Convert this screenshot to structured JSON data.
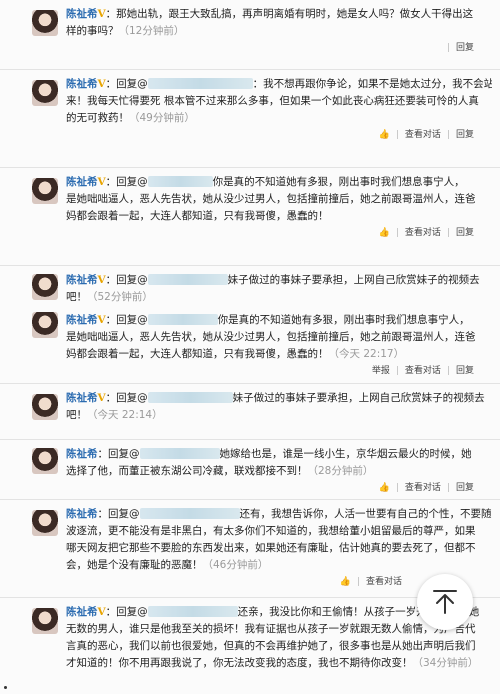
{
  "posts": [
    {
      "name": "陈祉希",
      "v": "V",
      "lines": [
        "：那她出轨，跟王大致乱搞，再声明离婚有明时，她是女人吗？做女人干得出这",
        "样的事吗？"
      ],
      "time": "（12分钟前）",
      "actions": {
        "like": "",
        "forward": "",
        "reply": "回复"
      }
    },
    {
      "name": "陈祉希",
      "v": "V",
      "prefix": "：回复@",
      "lines": [
        "：我不想再跟你争论，如果不是她太过分，我不会站出",
        "来！我每天忙得要死 根本管不过来那么多事，但如果一个如此丧心病狂还要装可怜的人真",
        "的无可救药！"
      ],
      "time": "（49分钟前）",
      "actions": {
        "like": "",
        "forward": "查看对话",
        "reply": "回复"
      }
    },
    {
      "name": "陈祉希",
      "v": "V",
      "prefix": "：回复@",
      "lines": [
        "你是真的不知道她有多狠，刚出事时我们想息事宁人，",
        "是她咄咄逼人，恶人先告状，她从没少过男人，包括撞前撞后，她之前跟哥温州人，连爸",
        "妈都会跟着一起，大连人都知道，只有我哥傻，愚蠢的！"
      ],
      "time": "",
      "actions": {
        "like": "",
        "forward": "查看对话",
        "reply": "回复"
      }
    },
    {
      "name": "陈祉希",
      "v": "V",
      "prefix": "：回复@",
      "lines": [
        "妹子做过的事妹子要承担，上网自己欣赏妹子的视频去",
        "吧！"
      ],
      "time": "（52分钟前）",
      "actions": {
        "like": "",
        "forward": "",
        "reply": ""
      }
    },
    {
      "name": "陈祉希",
      "v": "V",
      "prefix": "：回复@",
      "lines": [
        "你是真的不知道她有多狠，刚出事时我们想息事宁人，",
        "是她咄咄逼人，恶人先告状，她从没少过男人，包括撞前撞后，她之前跟哥温州人，连爸",
        "妈都会跟着一起，大连人都知道，只有我哥傻，愚蠢的！"
      ],
      "time": "（今天 22:17）",
      "actions": {
        "like": "举报",
        "forward": "查看对话",
        "reply": "回复"
      }
    },
    {
      "name": "陈祉希",
      "v": "V",
      "prefix": "：回复@",
      "lines": [
        "妹子做过的事妹子要承担，上网自己欣赏妹子的视频去",
        "吧！"
      ],
      "time": "（今天 22:14）",
      "actions": {
        "like": "",
        "forward": "",
        "reply": ""
      }
    },
    {
      "name": "陈祉希",
      "v": "",
      "prefix": "：回复@",
      "lines": [
        "她嫁给也是，谁是一线小生，京华烟云最火的时候，她",
        "选择了他，而董正被东湖公司冷藏，联戏都接不到！"
      ],
      "time": "（28分钟前）",
      "actions": {
        "like": "",
        "forward": "查看对话",
        "reply": "回复"
      }
    },
    {
      "name": "陈祉希",
      "v": "",
      "prefix": "：回复@",
      "lines": [
        "还有，我想告诉你，人活一世要有自己的个性，不要随",
        "波逐流，更不能没有是非黑白，有太多你们不知道的，我想给董小姐留最后的尊严，如果",
        "哪天网友把它那些不要脸的东西发出来，如果她还有廉耻，估计她真的要去死了，但都不",
        "会，她是个没有廉耻的恶魔！"
      ],
      "time": "（46分钟前）",
      "actions": {
        "like": "",
        "forward": "查看对话",
        "reply": ""
      }
    },
    {
      "name": "陈祉希",
      "v": "V",
      "prefix": "：回复@",
      "lines": [
        "还亲，我没比你和王偷情！从孩子一岁开始到现在她",
        "无数的男人，谁只是他我至关的损坏！我有证据也从孩子一岁就跟无数人偷情，为广告代",
        "言真的恶心，我们以前也很爱她，但真的不会再维护她了，很多事也是从她出声明后我们",
        "才知道的！你不用再跟我说了，你无法改变我的态度，我也不期待你改变！"
      ],
      "time": "（34分钟前）",
      "actions": {
        "like": "",
        "forward": "",
        "reply": ""
      }
    }
  ]
}
